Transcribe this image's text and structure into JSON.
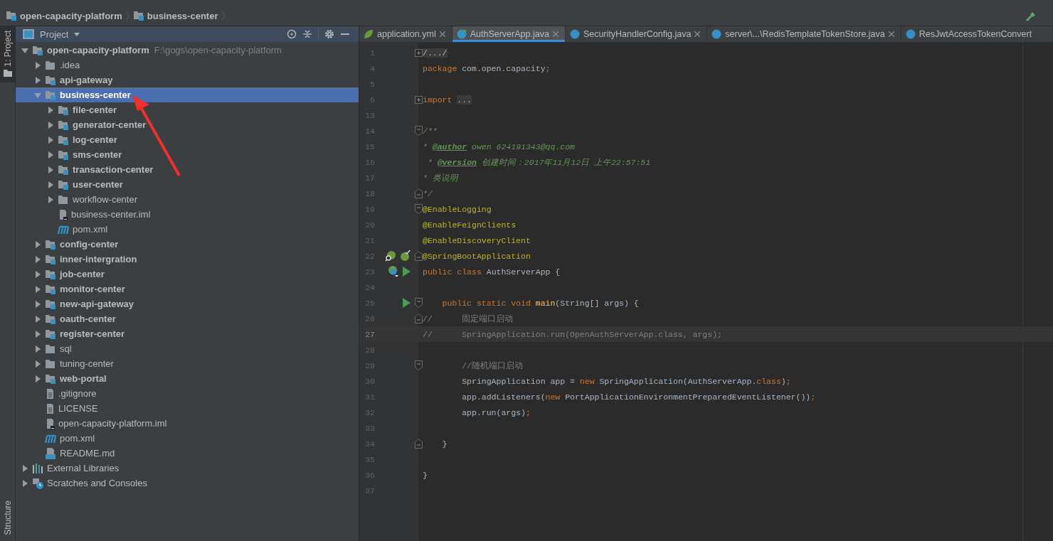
{
  "breadcrumbs": [
    {
      "label": "open-capacity-platform"
    },
    {
      "label": "business-center"
    }
  ],
  "tool_strip": {
    "top": [
      {
        "label": "1: Project",
        "selected": true
      }
    ],
    "bottom": [
      {
        "label": "Structure",
        "selected": false
      }
    ]
  },
  "project_panel": {
    "title": "Project",
    "tree": [
      {
        "label": "open-capacity-platform",
        "kind": "module",
        "path": "F:\\gogs\\open-capacity-platform",
        "expanded": true,
        "selected": false,
        "children": [
          {
            "label": ".idea",
            "kind": "folder",
            "expanded": false,
            "selected": false
          },
          {
            "label": "api-gateway",
            "kind": "module",
            "expanded": false,
            "selected": false
          },
          {
            "label": "business-center",
            "kind": "module",
            "expanded": true,
            "selected": true,
            "children": [
              {
                "label": "file-center",
                "kind": "module",
                "expanded": false,
                "selected": false
              },
              {
                "label": "generator-center",
                "kind": "module",
                "expanded": false,
                "selected": false
              },
              {
                "label": "log-center",
                "kind": "module",
                "expanded": false,
                "selected": false
              },
              {
                "label": "sms-center",
                "kind": "module",
                "expanded": false,
                "selected": false
              },
              {
                "label": "transaction-center",
                "kind": "module",
                "expanded": false,
                "selected": false
              },
              {
                "label": "user-center",
                "kind": "module",
                "expanded": false,
                "selected": false
              },
              {
                "label": "workflow-center",
                "kind": "folder",
                "expanded": false,
                "selected": false
              },
              {
                "label": "business-center.iml",
                "kind": "iml",
                "selected": false
              },
              {
                "label": "pom.xml",
                "kind": "maven",
                "selected": false
              }
            ]
          },
          {
            "label": "config-center",
            "kind": "module",
            "expanded": false,
            "selected": false
          },
          {
            "label": "inner-intergration",
            "kind": "module",
            "expanded": false,
            "selected": false
          },
          {
            "label": "job-center",
            "kind": "module",
            "expanded": false,
            "selected": false
          },
          {
            "label": "monitor-center",
            "kind": "module",
            "expanded": false,
            "selected": false
          },
          {
            "label": "new-api-gateway",
            "kind": "module",
            "expanded": false,
            "selected": false
          },
          {
            "label": "oauth-center",
            "kind": "module",
            "expanded": false,
            "selected": false
          },
          {
            "label": "register-center",
            "kind": "module",
            "expanded": false,
            "selected": false
          },
          {
            "label": "sql",
            "kind": "folder",
            "expanded": false,
            "selected": false
          },
          {
            "label": "tuning-center",
            "kind": "folder",
            "expanded": false,
            "selected": false
          },
          {
            "label": "web-portal",
            "kind": "module",
            "expanded": false,
            "selected": false
          },
          {
            "label": ".gitignore",
            "kind": "text",
            "selected": false
          },
          {
            "label": "LICENSE",
            "kind": "text",
            "selected": false
          },
          {
            "label": "open-capacity-platform.iml",
            "kind": "iml",
            "selected": false
          },
          {
            "label": "pom.xml",
            "kind": "maven",
            "selected": false
          },
          {
            "label": "README.md",
            "kind": "markdown",
            "selected": false
          }
        ]
      },
      {
        "label": "External Libraries",
        "kind": "libraries",
        "expanded": false,
        "selected": false
      },
      {
        "label": "Scratches and Consoles",
        "kind": "scratches",
        "expanded": false,
        "selected": false
      }
    ]
  },
  "editor": {
    "tabs": [
      {
        "label": "application.yml",
        "kind": "spring",
        "selected": false,
        "closable": true
      },
      {
        "label": "AuthServerApp.java",
        "kind": "spring-class",
        "selected": true,
        "closable": true
      },
      {
        "label": "SecurityHandlerConfig.java",
        "kind": "class",
        "selected": false,
        "closable": true
      },
      {
        "label": "server\\...\\RedisTemplateTokenStore.java",
        "kind": "class",
        "selected": false,
        "closable": true
      },
      {
        "label": "ResJwtAccessTokenConvert",
        "kind": "class",
        "selected": false,
        "closable": false
      }
    ],
    "lines": [
      {
        "number": "1",
        "fold": {
          "kind": "collapsed"
        },
        "current": false,
        "tokens": [
          {
            "kind": "folded",
            "text": "/.../"
          }
        ]
      },
      {
        "number": "4",
        "current": false,
        "tokens": [
          {
            "kind": "keyword",
            "text": "package"
          },
          {
            "kind": "plain",
            "text": " com.open.capacity"
          },
          {
            "kind": "keyword",
            "text": ";"
          }
        ]
      },
      {
        "number": "5",
        "current": false
      },
      {
        "number": "6",
        "fold": {
          "kind": "collapsed"
        },
        "current": false,
        "tokens": [
          {
            "kind": "keyword",
            "text": "import"
          },
          {
            "kind": "folded",
            "text": "..."
          }
        ]
      },
      {
        "number": "13",
        "current": false
      },
      {
        "number": "14",
        "fold": {
          "kind": "open"
        },
        "current": false,
        "tokens": [
          {
            "kind": "doc",
            "text": "/**"
          }
        ]
      },
      {
        "number": "15",
        "current": false,
        "tokens": [
          {
            "kind": "doc",
            "text": "* "
          },
          {
            "kind": "doctag",
            "text": "@author"
          },
          {
            "kind": "doc",
            "text": " owen 624191343@qq.com"
          }
        ]
      },
      {
        "number": "16",
        "current": false,
        "tokens": [
          {
            "kind": "doc",
            "text": " * "
          },
          {
            "kind": "doctag",
            "text": "@version"
          },
          {
            "kind": "doc",
            "text": " 创建时间：2017年11月12日 上午22:57:51"
          }
        ]
      },
      {
        "number": "17",
        "current": false,
        "tokens": [
          {
            "kind": "doc",
            "text": "* 类说明"
          }
        ]
      },
      {
        "number": "18",
        "fold": {
          "kind": "close"
        },
        "current": false,
        "tokens": [
          {
            "kind": "doc",
            "text": "*/"
          }
        ]
      },
      {
        "number": "19",
        "fold": {
          "kind": "open"
        },
        "current": false,
        "tokens": [
          {
            "kind": "annotation",
            "text": "@EnableLogging"
          }
        ]
      },
      {
        "number": "20",
        "current": false,
        "tokens": [
          {
            "kind": "annotation",
            "text": "@EnableFeignClients"
          }
        ]
      },
      {
        "number": "21",
        "current": false,
        "tokens": [
          {
            "kind": "annotation",
            "text": "@EnableDiscoveryClient"
          }
        ]
      },
      {
        "number": "22",
        "fold": {
          "kind": "close"
        },
        "current": false,
        "gutter": [
          {
            "kind": "spring-search"
          },
          {
            "kind": "spring-check"
          }
        ],
        "tokens": [
          {
            "kind": "annotation",
            "text": "@SpringBootApplication"
          }
        ]
      },
      {
        "number": "23",
        "current": false,
        "gutter": [
          {
            "kind": "spring-class"
          },
          {
            "kind": "run"
          }
        ],
        "tokens": [
          {
            "kind": "keyword",
            "text": "public class"
          },
          {
            "kind": "plain",
            "text": " AuthServerApp {"
          }
        ]
      },
      {
        "number": "24",
        "current": false
      },
      {
        "number": "25",
        "fold": {
          "kind": "open"
        },
        "current": false,
        "gutter": [
          {
            "kind": "run"
          }
        ],
        "tokens": [
          {
            "kind": "keyword",
            "text": "    public static void "
          },
          {
            "kind": "method",
            "text": "main"
          },
          {
            "kind": "plain",
            "text": "(String[] args) {"
          }
        ]
      },
      {
        "number": "26",
        "fold": {
          "kind": "close"
        },
        "current": false,
        "tokens": [
          {
            "kind": "comment",
            "text": "//      固定端口启动"
          }
        ]
      },
      {
        "number": "27",
        "current": true,
        "tokens": [
          {
            "kind": "comment",
            "text": "//      SpringApplication.run(OpenAuthServerApp.class, args);"
          }
        ]
      },
      {
        "number": "28",
        "current": false
      },
      {
        "number": "29",
        "fold": {
          "kind": "open"
        },
        "current": false,
        "tokens": [
          {
            "kind": "comment",
            "text": "        //随机端口启动"
          }
        ]
      },
      {
        "number": "30",
        "current": false,
        "tokens": [
          {
            "kind": "plain",
            "text": "        SpringApplication app = "
          },
          {
            "kind": "keyword",
            "text": "new"
          },
          {
            "kind": "plain",
            "text": " SpringApplication(AuthServerApp."
          },
          {
            "kind": "keyword",
            "text": "class"
          },
          {
            "kind": "plain",
            "text": ")"
          },
          {
            "kind": "keyword",
            "text": ";"
          }
        ]
      },
      {
        "number": "31",
        "current": false,
        "tokens": [
          {
            "kind": "plain",
            "text": "        app.addListeners("
          },
          {
            "kind": "keyword",
            "text": "new"
          },
          {
            "kind": "plain",
            "text": " PortApplicationEnvironmentPreparedEventListener())"
          },
          {
            "kind": "keyword",
            "text": ";"
          }
        ]
      },
      {
        "number": "32",
        "current": false,
        "tokens": [
          {
            "kind": "plain",
            "text": "        app.run(args)"
          },
          {
            "kind": "keyword",
            "text": ";"
          }
        ]
      },
      {
        "number": "33",
        "current": false
      },
      {
        "number": "34",
        "fold": {
          "kind": "close"
        },
        "current": false,
        "tokens": [
          {
            "kind": "plain",
            "text": "    }"
          }
        ]
      },
      {
        "number": "35",
        "current": false
      },
      {
        "number": "36",
        "current": false,
        "tokens": [
          {
            "kind": "plain",
            "text": "}"
          }
        ]
      },
      {
        "number": "37",
        "current": false
      }
    ]
  }
}
